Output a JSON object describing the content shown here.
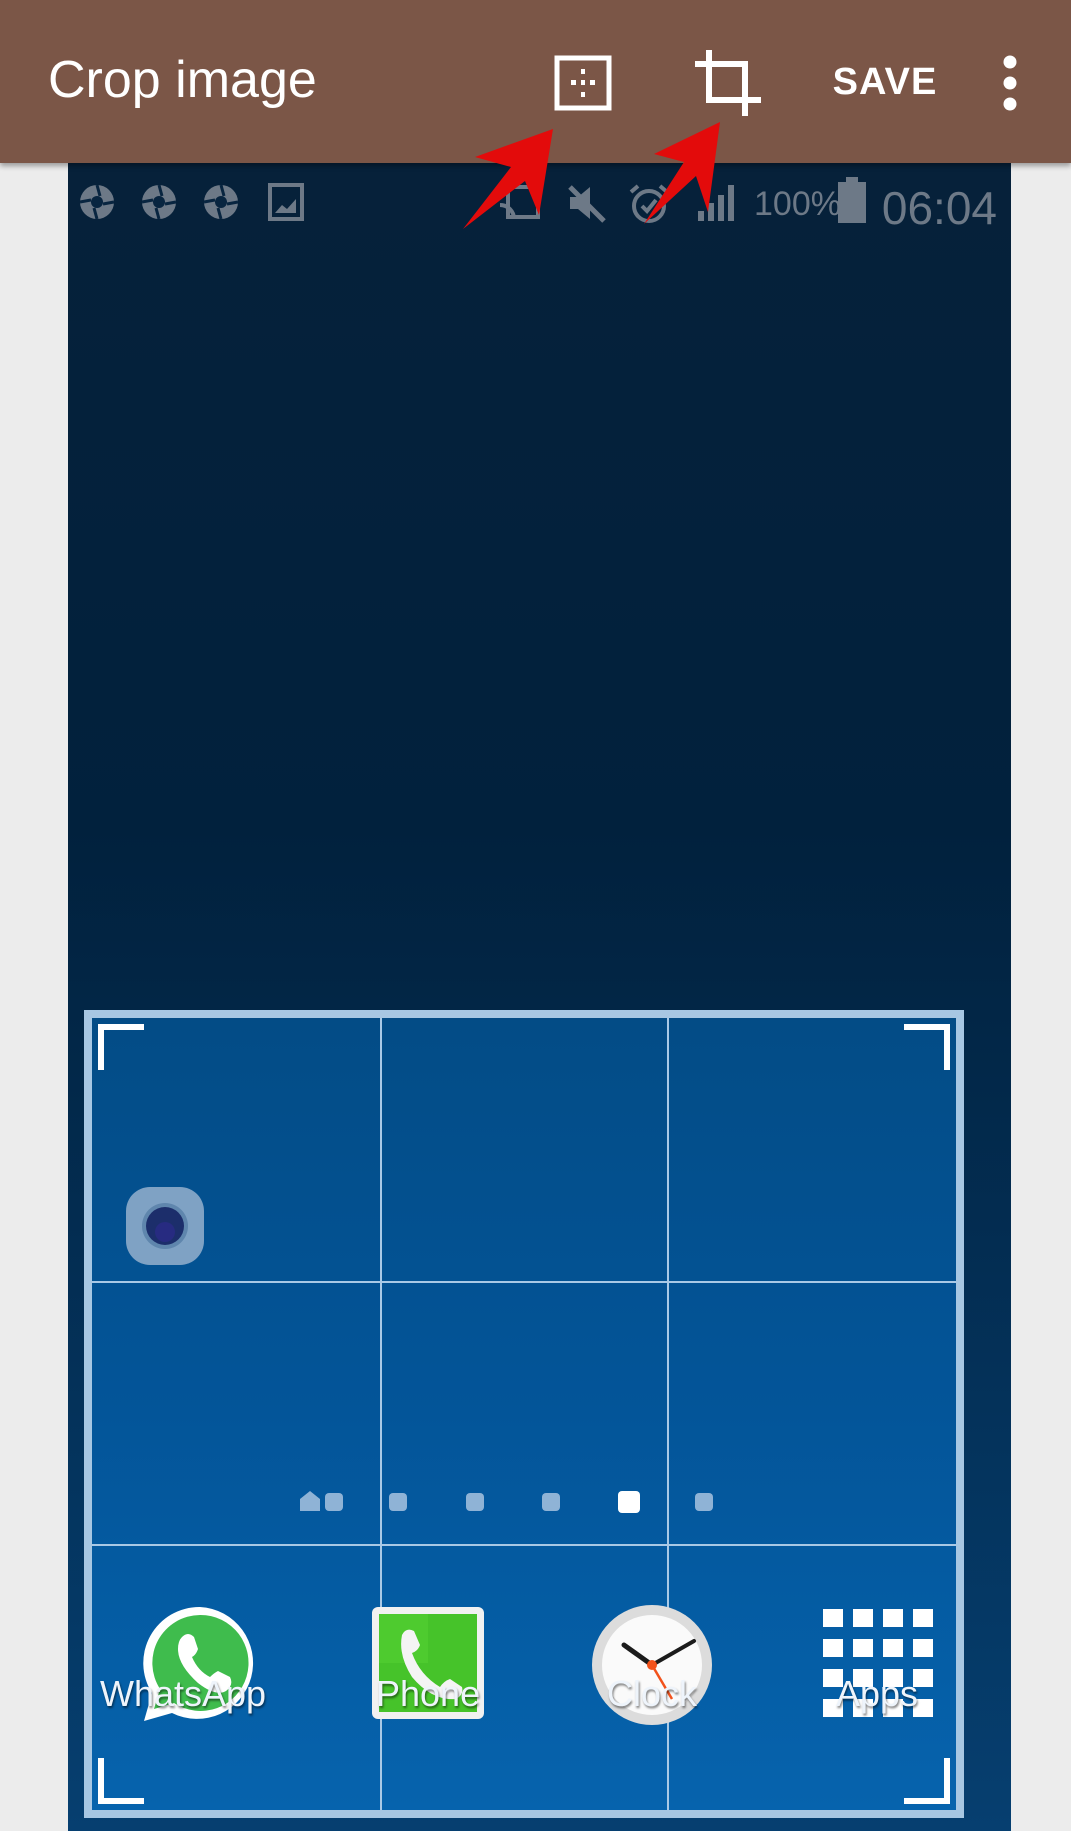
{
  "toolbar": {
    "title": "Crop image",
    "aspect_ratio_button": "aspect-ratio-icon",
    "crop_button": "crop-icon",
    "save_label": "SAVE",
    "overflow_menu": "more-vert-icon",
    "background_color": "#7b5647"
  },
  "status_bar": {
    "left_icons": [
      "aperture-icon",
      "aperture-icon",
      "aperture-icon",
      "gallery-icon"
    ],
    "right_icons": [
      "cast-icon",
      "mute-icon",
      "alarm-icon",
      "signal-icon"
    ],
    "battery_percent": "100%",
    "time": "06:04"
  },
  "home_screen": {
    "page_indicator": {
      "count": 7,
      "active_index": 5,
      "first_is_home": true
    },
    "dock": [
      {
        "label": "WhatsApp",
        "icon": "whatsapp-icon"
      },
      {
        "label": "Phone",
        "icon": "phone-icon"
      },
      {
        "label": "Clock",
        "icon": "clock-icon"
      },
      {
        "label": "Apps",
        "icon": "apps-grid-icon"
      }
    ]
  },
  "annotations": {
    "arrows": 2,
    "color": "#e30b0b"
  }
}
